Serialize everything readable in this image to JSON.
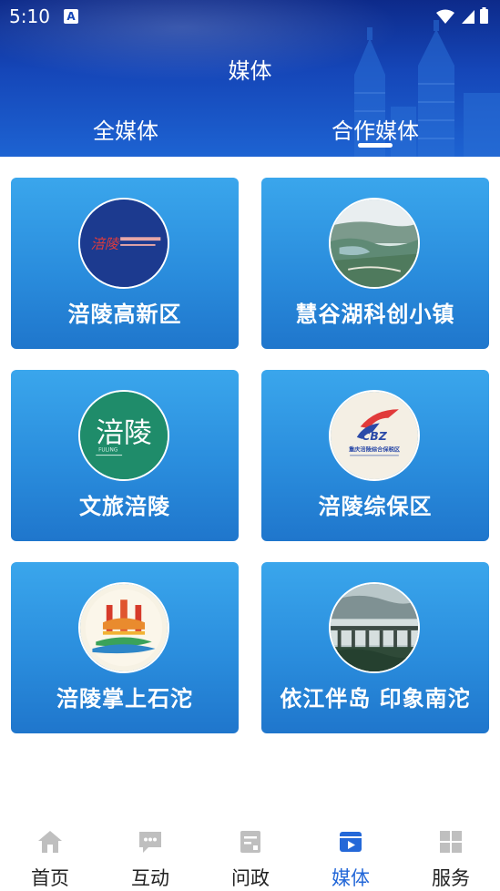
{
  "status_bar": {
    "time": "5:10",
    "notification_badge": "A"
  },
  "header": {
    "title": "媒体"
  },
  "tabs": [
    {
      "label": "全媒体",
      "active": false
    },
    {
      "label": "合作媒体",
      "active": true
    }
  ],
  "cards": [
    {
      "label": "涪陵高新区",
      "logo": "fuling-hightech-logo"
    },
    {
      "label": "慧谷湖科创小镇",
      "logo": "lake-landscape-photo"
    },
    {
      "label": "文旅涪陵",
      "logo": "culture-tourism-logo"
    },
    {
      "label": "涪陵综保区",
      "logo": "cbz-logo"
    },
    {
      "label": "涪陵掌上石沱",
      "logo": "shituo-logo"
    },
    {
      "label": "依江伴岛 印象南沱",
      "logo": "bridge-mist-photo"
    }
  ],
  "logo_text": {
    "fuling_hightech": "涪陵",
    "culture_tourism": "涪陵",
    "culture_tourism_en": "FULING",
    "cbz": "CBZ",
    "cbz_name": "重庆涪陵综合保税区"
  },
  "bottom_nav": [
    {
      "label": "首页",
      "icon": "home-icon",
      "active": false
    },
    {
      "label": "互动",
      "icon": "chat-icon",
      "active": false
    },
    {
      "label": "问政",
      "icon": "document-icon",
      "active": false
    },
    {
      "label": "媒体",
      "icon": "video-icon",
      "active": true
    },
    {
      "label": "服务",
      "icon": "grid-icon",
      "active": false
    }
  ],
  "colors": {
    "header": "#1546b8",
    "card": "#2a8ddd",
    "active_tab": "#2468d8",
    "inactive_tab": "#bfbfbf"
  }
}
